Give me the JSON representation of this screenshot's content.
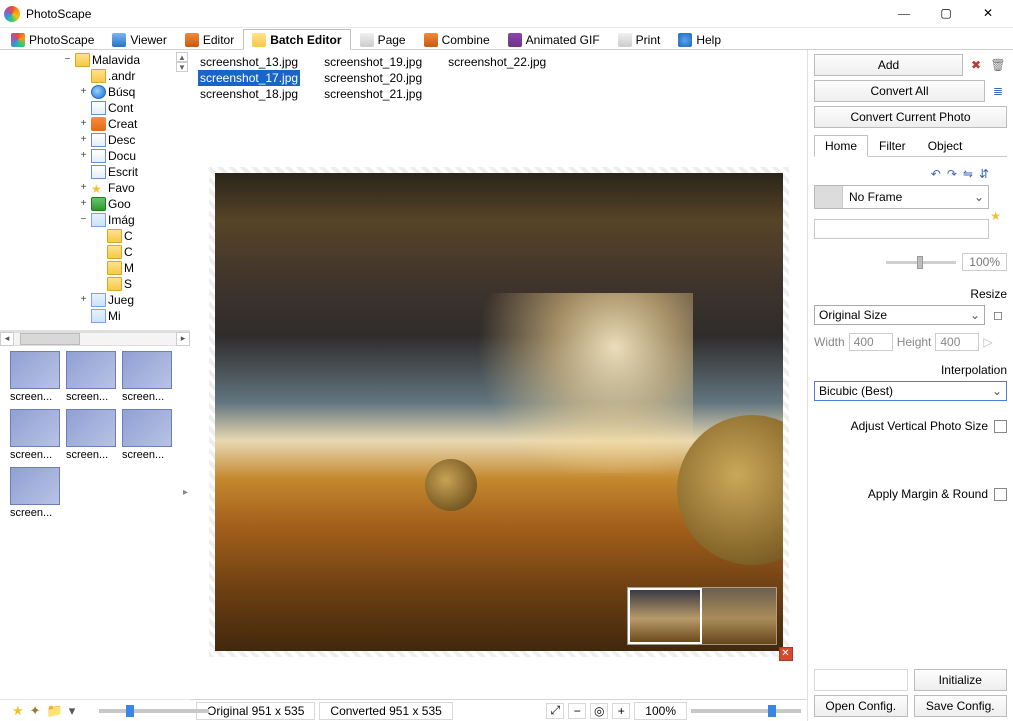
{
  "title": "PhotoScape",
  "window_controls": {
    "min": "—",
    "max": "▢",
    "close": "✕"
  },
  "tabs": [
    {
      "label": "PhotoScape"
    },
    {
      "label": "Viewer"
    },
    {
      "label": "Editor"
    },
    {
      "label": "Batch Editor",
      "active": true
    },
    {
      "label": "Page"
    },
    {
      "label": "Combine"
    },
    {
      "label": "Animated GIF"
    },
    {
      "label": "Print"
    },
    {
      "label": "Help"
    }
  ],
  "tree": {
    "root": "Malavida",
    "items": [
      {
        "indent": 1,
        "exp": "",
        "icon": "folder",
        "label": ".andr"
      },
      {
        "indent": 1,
        "exp": "+",
        "icon": "search",
        "label": "Búsq"
      },
      {
        "indent": 1,
        "exp": "",
        "icon": "doc",
        "label": "Cont"
      },
      {
        "indent": 1,
        "exp": "+",
        "icon": "pen",
        "label": "Creat"
      },
      {
        "indent": 1,
        "exp": "+",
        "icon": "arrow",
        "label": "Desc"
      },
      {
        "indent": 1,
        "exp": "+",
        "icon": "doc",
        "label": "Docu"
      },
      {
        "indent": 1,
        "exp": "",
        "icon": "doc",
        "label": "Escrit"
      },
      {
        "indent": 1,
        "exp": "+",
        "icon": "star",
        "label": "Favo"
      },
      {
        "indent": 1,
        "exp": "+",
        "icon": "drive",
        "label": "Goo"
      },
      {
        "indent": 1,
        "exp": "−",
        "icon": "img",
        "label": "Imág"
      },
      {
        "indent": 2,
        "exp": "",
        "icon": "folder",
        "label": "C"
      },
      {
        "indent": 2,
        "exp": "",
        "icon": "folder",
        "label": "C"
      },
      {
        "indent": 2,
        "exp": "",
        "icon": "folder",
        "label": "M"
      },
      {
        "indent": 2,
        "exp": "",
        "icon": "folder",
        "label": "S"
      },
      {
        "indent": 1,
        "exp": "+",
        "icon": "game",
        "label": "Jueg"
      },
      {
        "indent": 1,
        "exp": "",
        "icon": "music",
        "label": "Mi"
      }
    ]
  },
  "thumbs": [
    "screen...",
    "screen...",
    "screen...",
    "screen...",
    "screen...",
    "screen...",
    "screen..."
  ],
  "files": [
    "screenshot_13.jpg",
    "screenshot_17.jpg",
    "screenshot_18.jpg",
    "screenshot_19.jpg",
    "screenshot_20.jpg",
    "screenshot_21.jpg",
    "screenshot_22.jpg"
  ],
  "selected_file_index": 1,
  "right": {
    "add": "Add",
    "convert_all": "Convert All",
    "convert_current": "Convert Current Photo",
    "tabs": [
      "Home",
      "Filter",
      "Object"
    ],
    "active_tab": 0,
    "frame_label": "No Frame",
    "slider_pct": "100%",
    "resize_label": "Resize",
    "resize_mode": "Original Size",
    "width_label": "Width",
    "width_val": "400",
    "height_label": "Height",
    "height_val": "400",
    "interpolation_label": "Interpolation",
    "interpolation_val": "Bicubic (Best)",
    "adjust_vert": "Adjust Vertical Photo Size",
    "apply_margin": "Apply Margin & Round",
    "initialize": "Initialize",
    "open_config": "Open Config.",
    "save_config": "Save Config."
  },
  "status": {
    "original": "Original 951 x 535",
    "converted": "Converted 951 x 535",
    "zoom": "100%"
  }
}
